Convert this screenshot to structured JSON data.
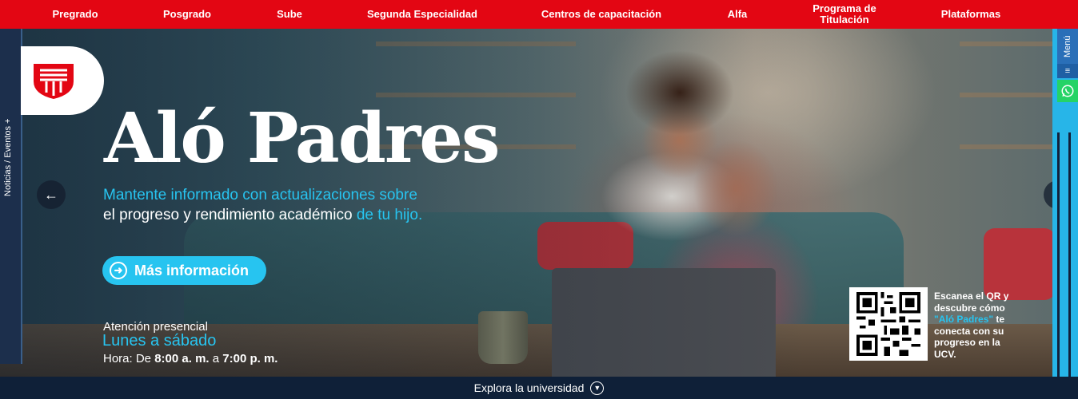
{
  "topnav": {
    "items": [
      {
        "label": "Pregrado"
      },
      {
        "label": "Posgrado"
      },
      {
        "label": "Sube"
      },
      {
        "label": "Segunda Especialidad"
      },
      {
        "label": "Centros de capacitación"
      },
      {
        "label": "Alfa"
      },
      {
        "label": "Programa de Titulación"
      },
      {
        "label": "Plataformas"
      }
    ]
  },
  "side": {
    "noticias_label": "Noticias / Eventos +"
  },
  "hero": {
    "title": "Aló Padres",
    "subtitle_line1": "Mantente informado con actualizaciones sobre",
    "subtitle_line2": "el progreso y rendimiento académico",
    "subtitle_line2_hl": " de tu hijo.",
    "button_label": "Más información",
    "attention_label": "Atención presencial",
    "days": "Lunes a sábado",
    "hours_prefix": "Hora: De ",
    "hours_from": "8:00 a. m.",
    "hours_mid": " a ",
    "hours_to": "7:00 p. m.",
    "qr_text_1": "Escanea el QR y descubre cómo ",
    "qr_text_hl": "\"Aló Padres\"",
    "qr_text_2": " te conecta con su progreso en la UCV."
  },
  "right": {
    "menu_label": "Menú"
  },
  "bottom": {
    "explore_label": "Explora la universidad"
  },
  "colors": {
    "brand_red": "#e30613",
    "accent_cyan": "#27c4f0",
    "dark_navy": "#0f2038"
  },
  "icons": {
    "prev": "arrow-left-icon",
    "next": "arrow-right-icon",
    "button": "circle-arrow-right-icon",
    "whatsapp": "whatsapp-icon",
    "menu": "hamburger-icon",
    "explore": "chevron-down-circle-icon"
  }
}
